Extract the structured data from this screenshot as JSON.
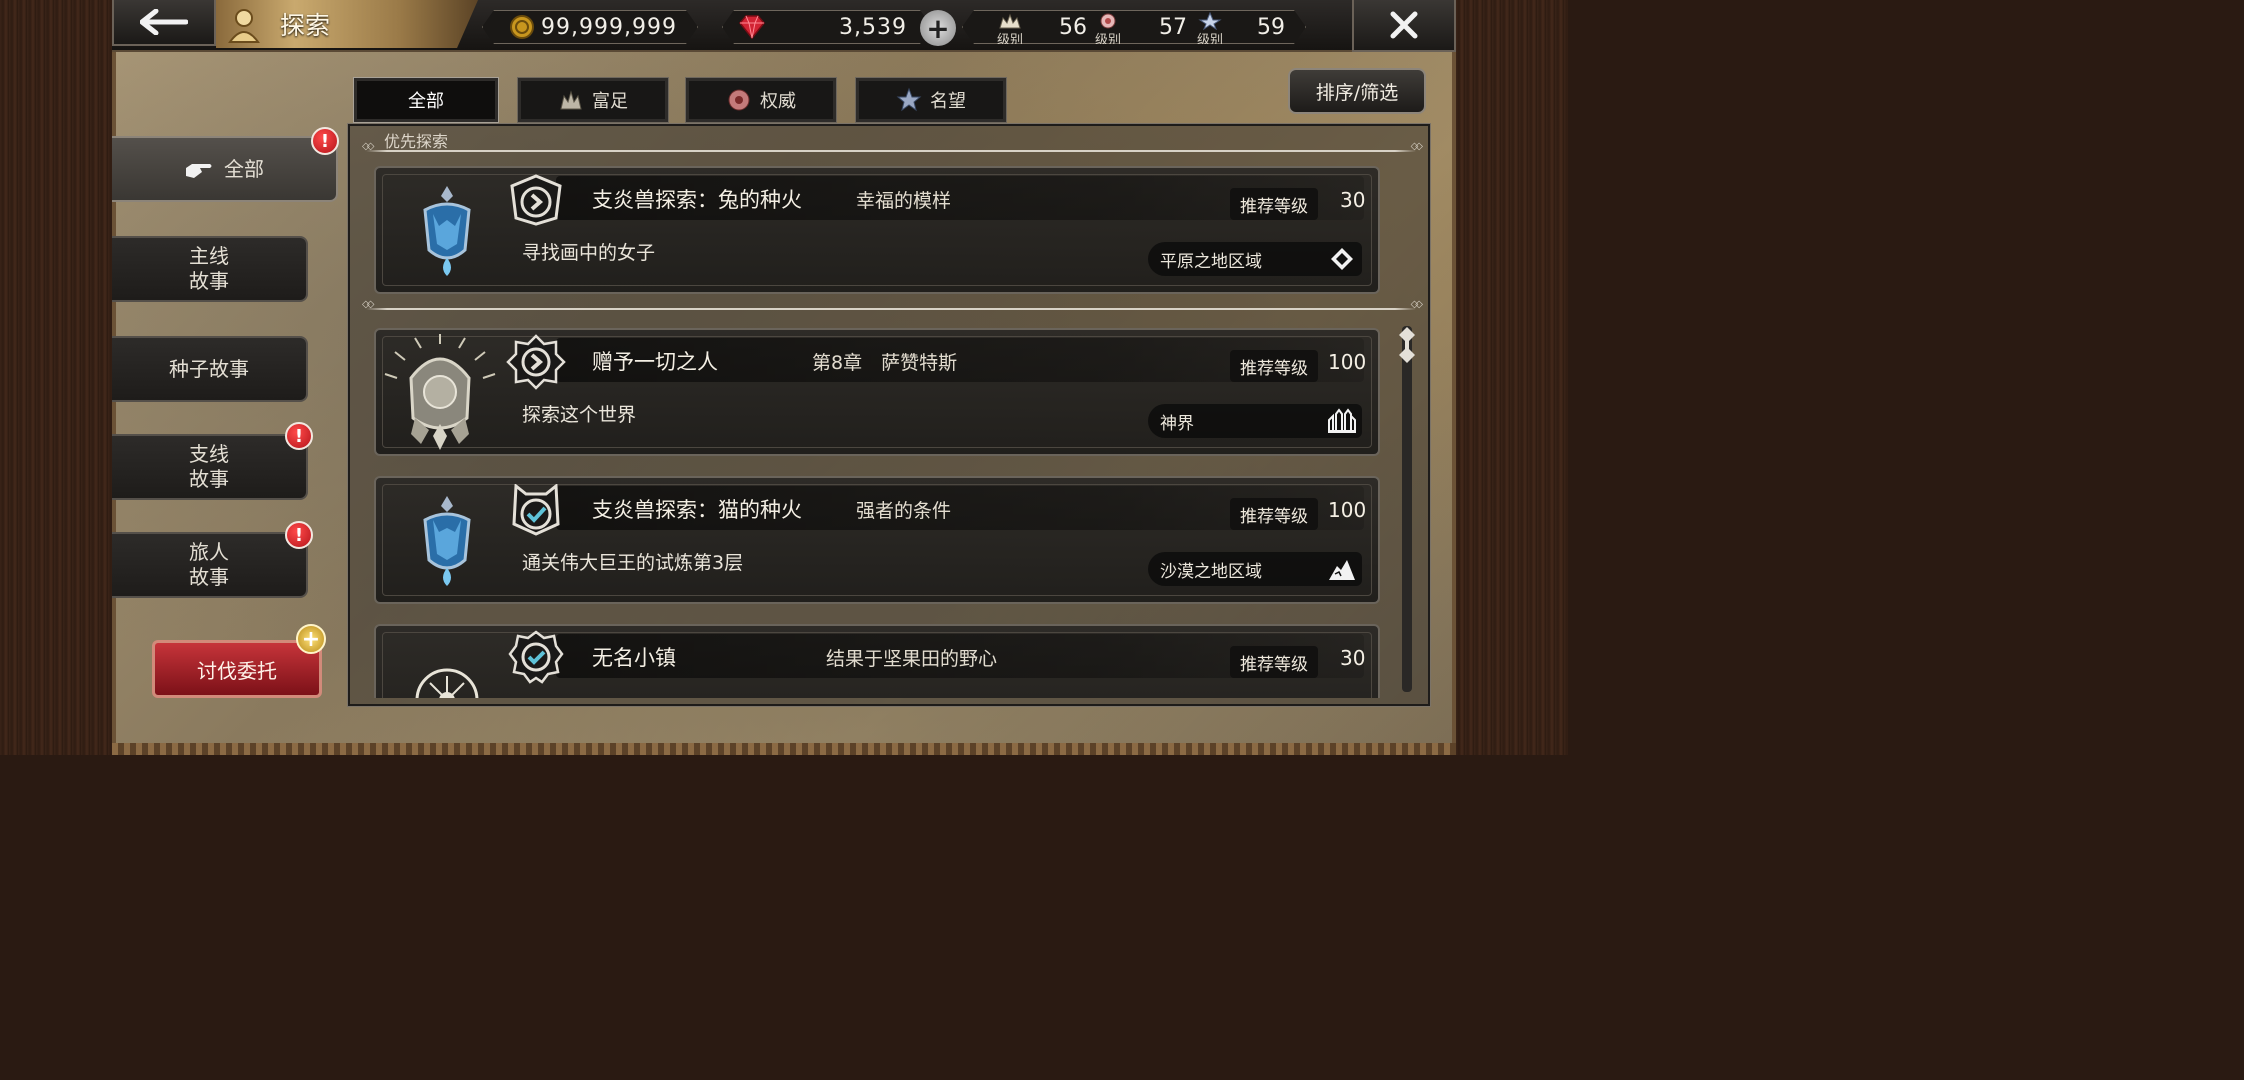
{
  "header": {
    "title": "探索",
    "gold": "99,999,999",
    "gems": "3,539",
    "levels": [
      {
        "label": "级别",
        "value": "56"
      },
      {
        "label": "级别",
        "value": "57"
      },
      {
        "label": "级别",
        "value": "59"
      }
    ]
  },
  "tabs": [
    {
      "label": "全部",
      "active": true
    },
    {
      "label": "富足",
      "icon": "wealth-icon"
    },
    {
      "label": "权威",
      "icon": "power-icon"
    },
    {
      "label": "名望",
      "icon": "fame-icon"
    }
  ],
  "sort_filter": "排序/筛选",
  "sidebar": {
    "items": [
      {
        "label": "全部",
        "alert": true
      },
      {
        "label": "主线\n故事",
        "alert": false
      },
      {
        "label": "种子故事",
        "alert": false
      },
      {
        "label": "支线\n故事",
        "alert": true
      },
      {
        "label": "旅人\n故事",
        "alert": true
      }
    ],
    "hunt_button": "讨伐委托",
    "hunt_badge": "+"
  },
  "priority_label": "优先探索",
  "quests": [
    {
      "name": "支炎兽探索：兔的种火",
      "sub": "幸福的模样",
      "rec_label": "推荐等级",
      "rec_level": "30",
      "desc": "寻找画中的女子",
      "region": "平原之地区域",
      "status": "arrow"
    },
    {
      "name": "赠予一切之人",
      "sub": "第8章　萨赞特斯",
      "rec_label": "推荐等级",
      "rec_level": "100",
      "desc": "探索这个世界",
      "region": "神界",
      "status": "arrow"
    },
    {
      "name": "支炎兽探索：猫的种火",
      "sub": "强者的条件",
      "rec_label": "推荐等级",
      "rec_level": "100",
      "desc": "通关伟大巨王的试炼第3层",
      "region": "沙漠之地区域",
      "status": "check"
    },
    {
      "name": "无名小镇",
      "sub": "结果于坚果田的野心",
      "rec_label": "推荐等级",
      "rec_level": "30",
      "desc": "",
      "region": "",
      "status": "check"
    }
  ],
  "colors": {
    "alert": "#d81c22",
    "hunt": "#a3232a",
    "accent_gold": "#c9a96e"
  }
}
